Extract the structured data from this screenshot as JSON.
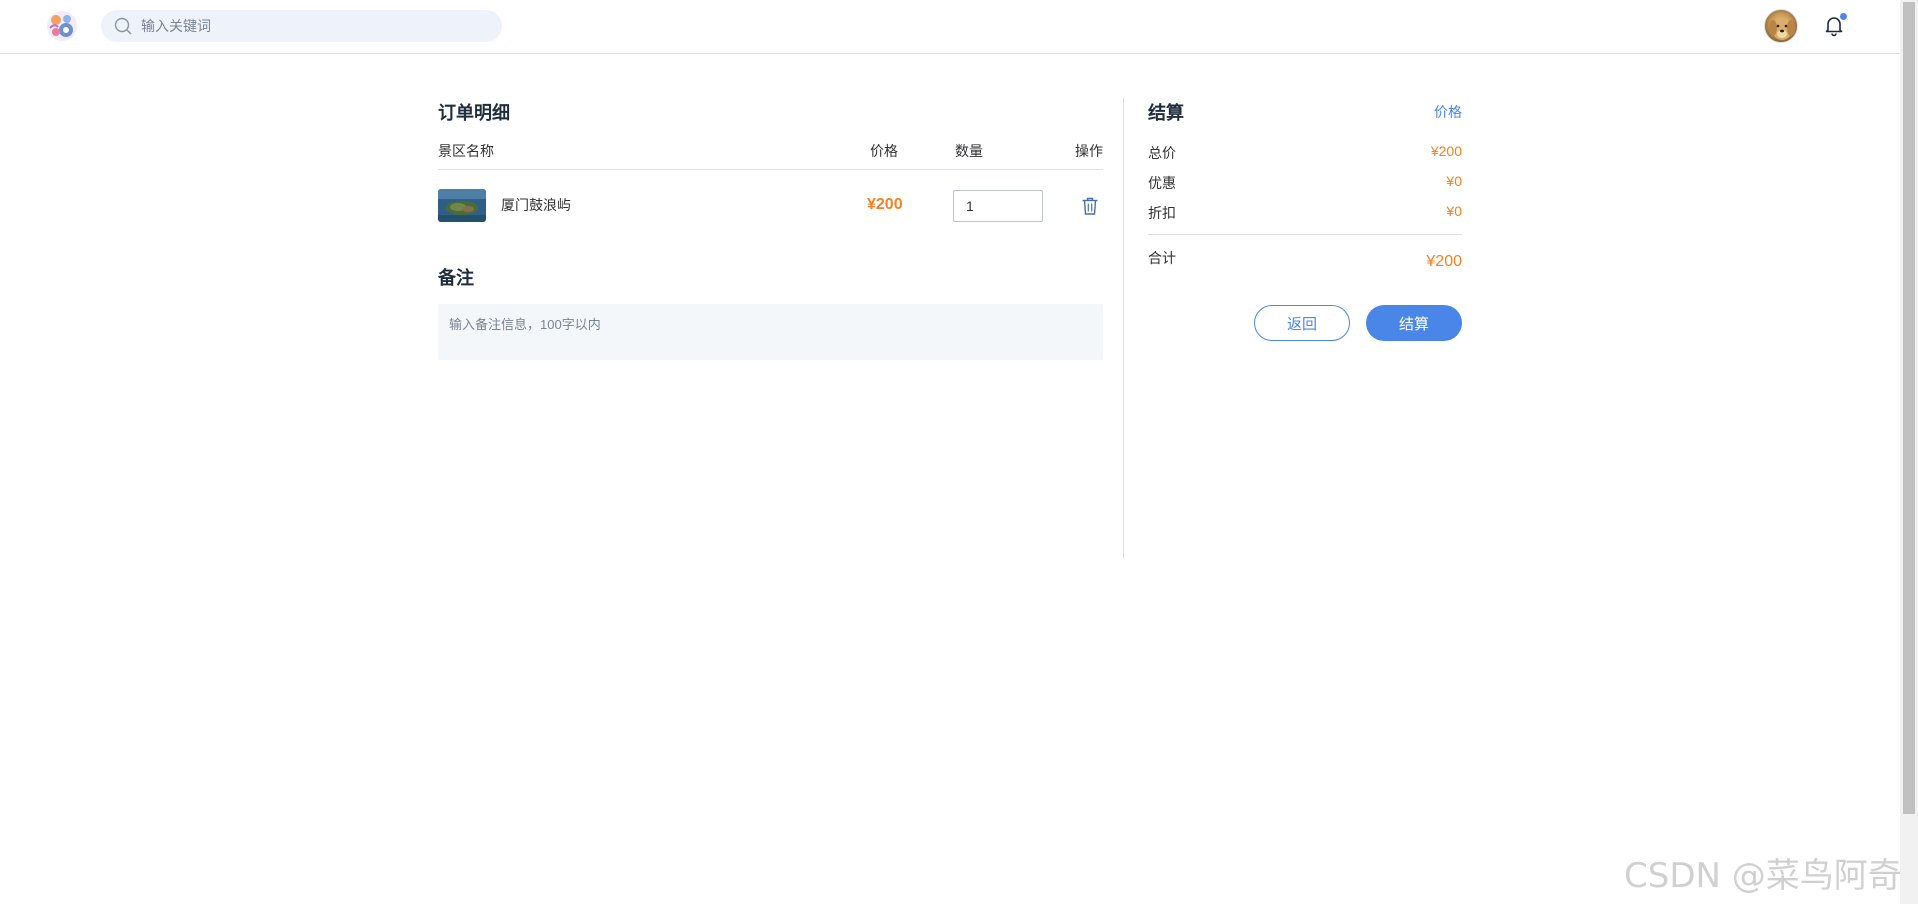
{
  "header": {
    "search_placeholder": "输入关键词",
    "notification_unread": true
  },
  "order": {
    "title": "订单明细",
    "columns": {
      "name": "景区名称",
      "price": "价格",
      "quantity": "数量",
      "action": "操作"
    },
    "items": [
      {
        "name": "厦门鼓浪屿",
        "price": "¥200",
        "quantity": "1"
      }
    ]
  },
  "remark": {
    "title": "备注",
    "placeholder": "输入备注信息，100字以内"
  },
  "checkout": {
    "title": "结算",
    "price_link": "价格",
    "rows": [
      {
        "label": "总价",
        "value": "¥200"
      },
      {
        "label": "优惠",
        "value": "¥0"
      },
      {
        "label": "折扣",
        "value": "¥0"
      }
    ],
    "total_label": "合计",
    "total_value": "¥200",
    "back_label": "返回",
    "pay_label": "结算"
  },
  "watermark": "CSDN @菜鸟阿奇",
  "colors": {
    "accent": "#4a86e8",
    "price": "#f5811f",
    "search_bg": "#eef3fb"
  }
}
